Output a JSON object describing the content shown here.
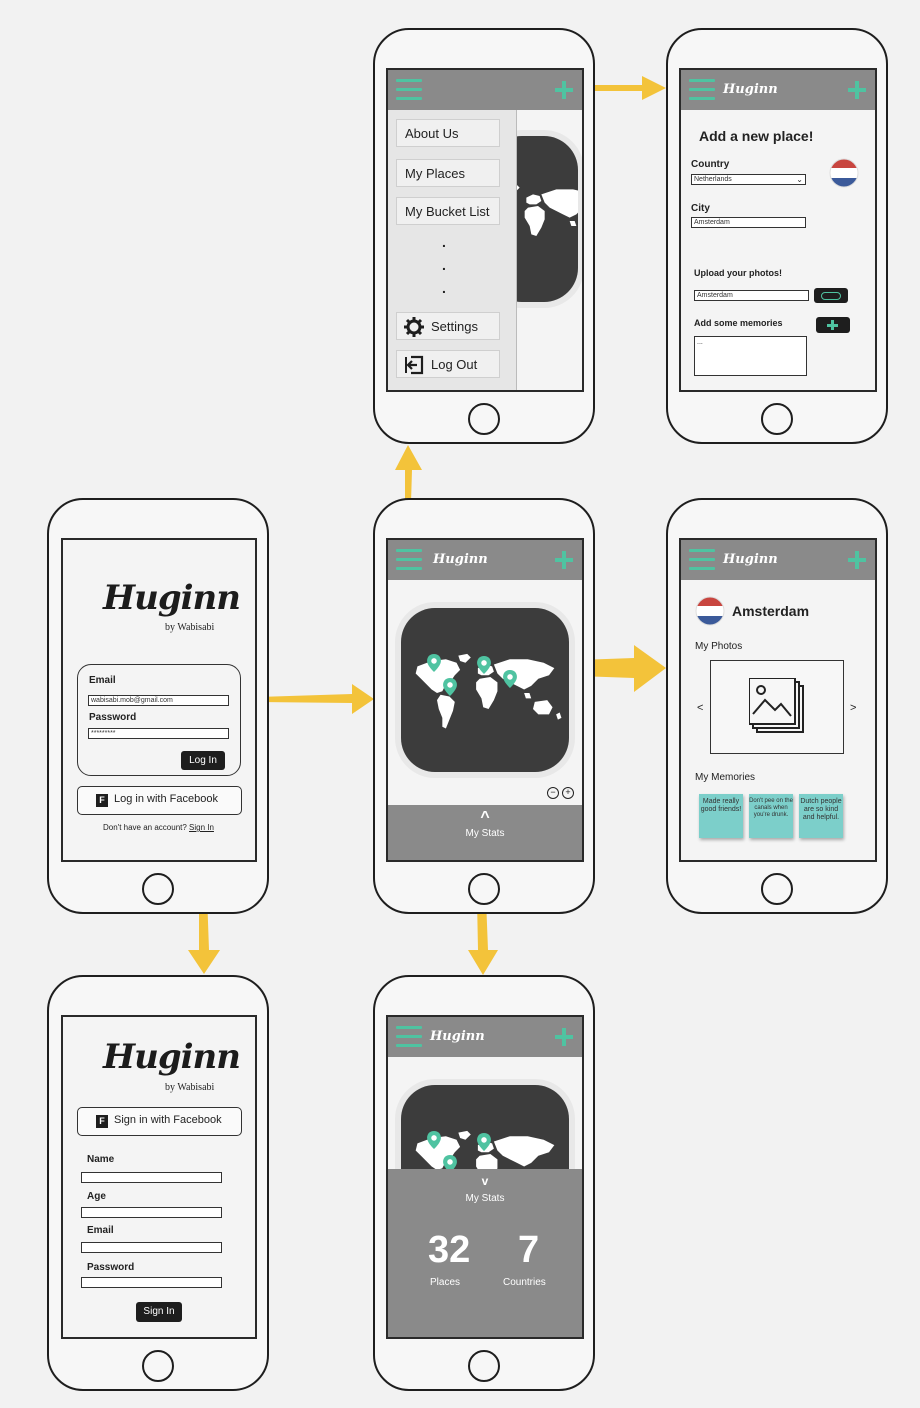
{
  "brand": "Huginn",
  "by": "by Wabisabi",
  "login": {
    "email_label": "Email",
    "email_value": "wabisabi.mob@gmail.com",
    "password_label": "Password",
    "password_value": "*********",
    "login_button": "Log In",
    "facebook_button": "Log in with Facebook",
    "no_account_text": "Don't have an account?",
    "sign_in_link": "Sign In"
  },
  "signup": {
    "facebook_button": "Sign in with Facebook",
    "name_label": "Name",
    "age_label": "Age",
    "email_label": "Email",
    "password_label": "Password",
    "sign_in_button": "Sign In"
  },
  "menu": {
    "items": [
      "About Us",
      "My Places",
      "My Bucket List"
    ],
    "dots": ".",
    "settings": "Settings",
    "logout": "Log Out"
  },
  "add_place": {
    "title": "Add a new place!",
    "country_label": "Country",
    "country_value": "Netherlands",
    "city_label": "City",
    "city_value": "Amsterdam",
    "upload_label": "Upload your photos!",
    "upload_value": "Amsterdam",
    "memories_label": "Add some memories",
    "memories_value": "..."
  },
  "main": {
    "stats_label": "My Stats",
    "caret_up": "^"
  },
  "city": {
    "name": "Amsterdam",
    "photos_label": "My Photos",
    "prev": "<",
    "next": ">",
    "memories_label": "My Memories",
    "notes": [
      "Made really good friends!",
      "Don't pee on the canals when you're drunk.",
      "Dutch people are so kind and helpful."
    ]
  },
  "stats": {
    "caret_down": "v",
    "title": "My Stats",
    "places_count": "32",
    "places_label": "Places",
    "countries_count": "7",
    "countries_label": "Countries"
  },
  "colors": {
    "accent": "#4fc3a1",
    "header_gray": "#8a8a8a",
    "arrow": "#f3c33a",
    "note": "#7ccfca"
  }
}
